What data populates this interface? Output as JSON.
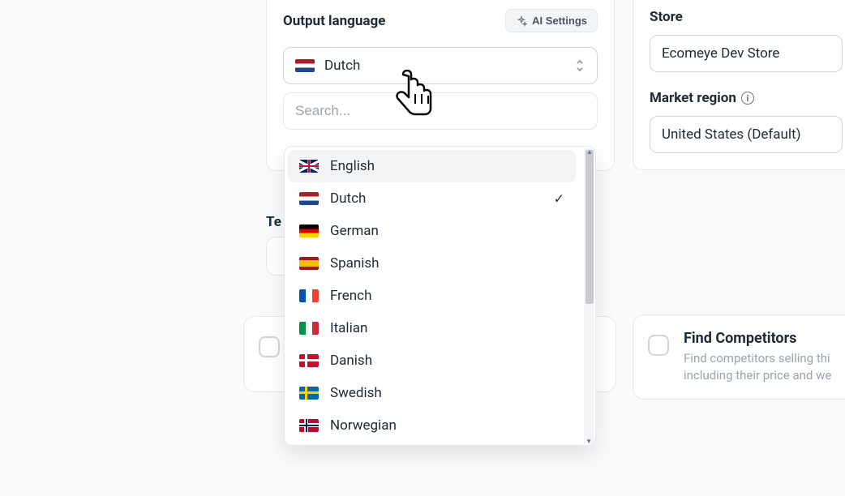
{
  "outputLanguage": {
    "title": "Output language",
    "aiSettingsLabel": "AI Settings",
    "selected": "Dutch",
    "searchPlaceholder": "Search..."
  },
  "languageOptions": {
    "english": "English",
    "dutch": "Dutch",
    "german": "German",
    "spanish": "Spanish",
    "french": "French",
    "italian": "Italian",
    "danish": "Danish",
    "swedish": "Swedish",
    "norwegian": "Norwegian"
  },
  "partialLabel": "Te",
  "store": {
    "title": "Store",
    "value": "Ecomeye Dev Store"
  },
  "marketRegion": {
    "title": "Market region",
    "value": "United States (Default)"
  },
  "findCompetitors": {
    "title": "Find Competitors",
    "desc": "Find competitors selling thi including their price and we"
  }
}
